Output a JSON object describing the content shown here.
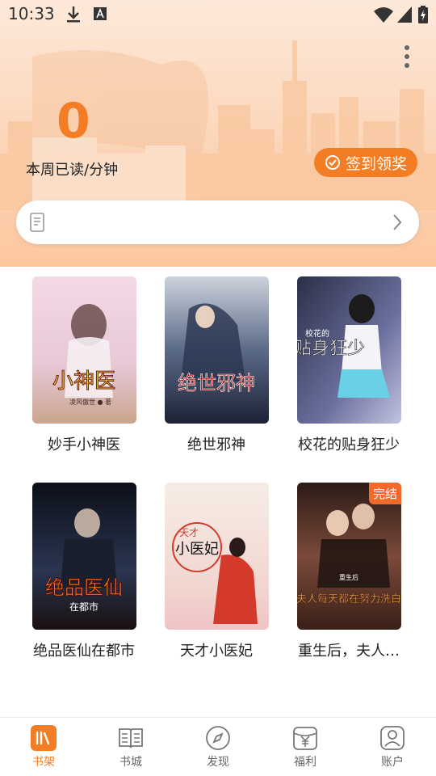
{
  "status_bar": {
    "time": "10:33"
  },
  "header": {
    "read_count": "0",
    "read_label": "本周已读/分钟",
    "checkin_label": "签到领奖"
  },
  "books": [
    {
      "title": "妙手小神医",
      "cover_text": "小神医",
      "cover_small": "凌风傲世 ● 著",
      "colors": [
        "#f3d9e6",
        "#b78ab0",
        "#e7c0a0"
      ]
    },
    {
      "title": "绝世邪神",
      "cover_text": "绝世邪神",
      "cover_small": "",
      "colors": [
        "#cdd3dc",
        "#3e4a66",
        "#1c2235"
      ]
    },
    {
      "title": "校花的贴身狂少",
      "cover_text": "贴身狂少",
      "cover_small": "校花的",
      "colors": [
        "#2a3048",
        "#6b6f9e",
        "#6ad0e6"
      ]
    },
    {
      "title": "绝品医仙在都市",
      "cover_text": "绝品医仙",
      "cover_small": "在都市",
      "colors": [
        "#0c0f18",
        "#2a3550",
        "#d84315"
      ]
    },
    {
      "title": "天才小医妃",
      "cover_text": "小医妃",
      "cover_small": "天才",
      "colors": [
        "#f6ede6",
        "#efc4c4",
        "#d33a2c"
      ]
    },
    {
      "title": "重生后，夫人…",
      "cover_text": "夫人每天都在努力洗白",
      "cover_small": "重生后",
      "badge": "完结",
      "colors": [
        "#2c1b16",
        "#7a4a3a",
        "#e8b8a0"
      ]
    }
  ],
  "tabs": [
    {
      "label": "书架",
      "icon": "bookshelf-icon",
      "active": true
    },
    {
      "label": "书城",
      "icon": "book-open-icon",
      "active": false
    },
    {
      "label": "发现",
      "icon": "compass-icon",
      "active": false
    },
    {
      "label": "福利",
      "icon": "gift-yen-icon",
      "active": false
    },
    {
      "label": "账户",
      "icon": "user-icon",
      "active": false
    }
  ],
  "colors": {
    "accent": "#f27d24",
    "text": "#222222",
    "tab_inactive": "#666666"
  }
}
